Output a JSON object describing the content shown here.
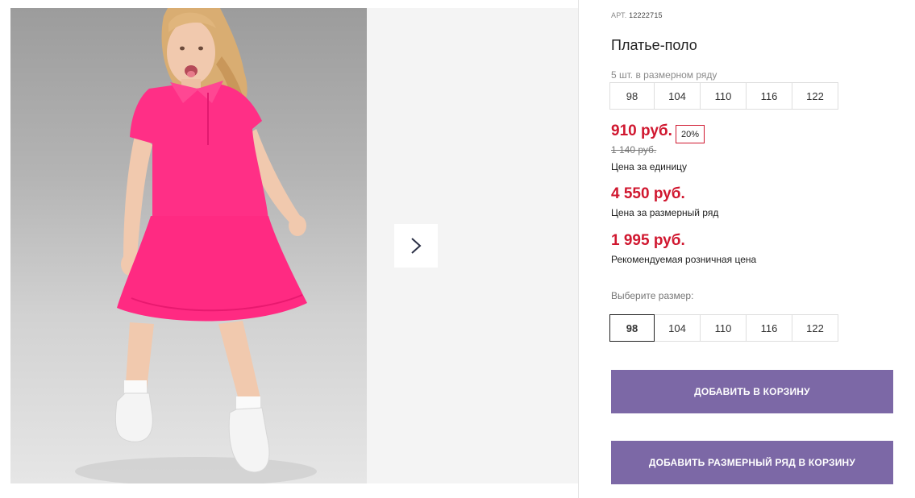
{
  "product": {
    "art_label": "АРТ.",
    "art_value": "12222715",
    "title": "Платье-поло"
  },
  "pack": {
    "note": "5 шт. в размерном ряду",
    "sizes": [
      "98",
      "104",
      "110",
      "116",
      "122"
    ]
  },
  "prices": {
    "unit_price": "910 руб.",
    "discount": "20%",
    "old_price": "1 140 руб.",
    "unit_label": "Цена за единицу",
    "row_price": "4 550 руб.",
    "row_label": "Цена за размерный ряд",
    "retail_price": "1 995 руб.",
    "retail_label": "Рекомендуемая розничная цена"
  },
  "size_select": {
    "label": "Выберите размер:",
    "sizes": [
      "98",
      "104",
      "110",
      "116",
      "122"
    ],
    "selected": "98"
  },
  "actions": {
    "add_to_cart": "ДОБАВИТЬ В КОРЗИНУ",
    "add_row_to_cart": "ДОБАВИТЬ РАЗМЕРНЫЙ РЯД В КОРЗИНУ"
  },
  "gallery": {
    "next_icon": "chevron-right-icon"
  },
  "colors": {
    "price_red": "#d0172f",
    "button_purple": "#7c68a6",
    "dress_pink": "#ff2f86"
  }
}
